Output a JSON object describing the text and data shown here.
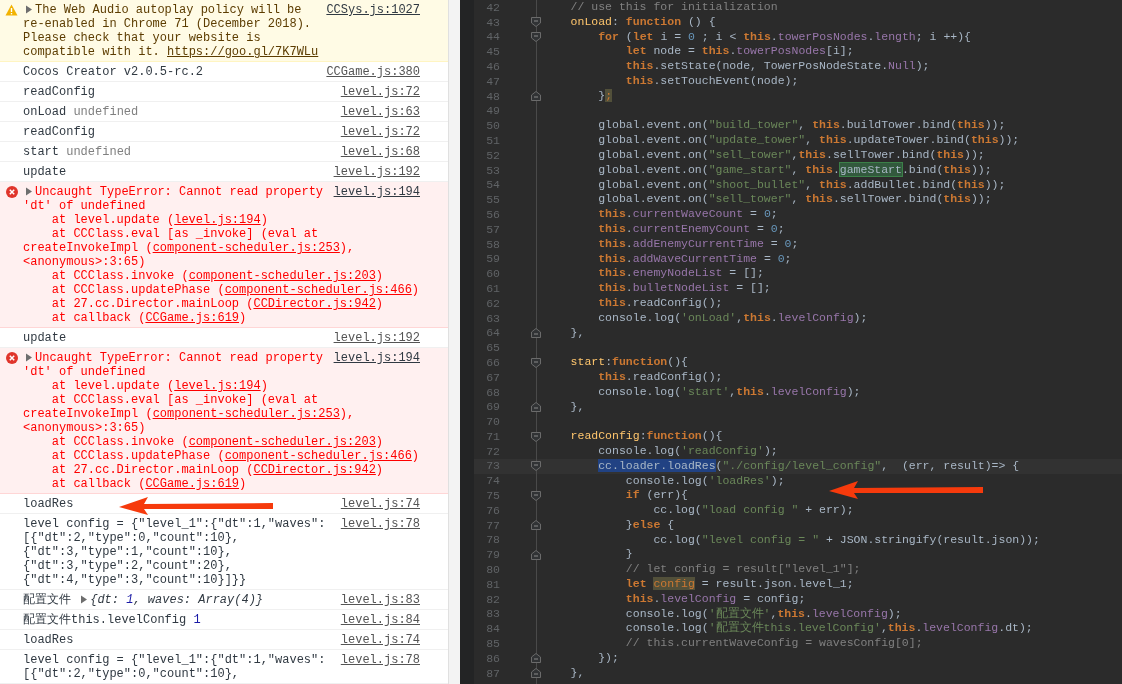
{
  "console": {
    "entries": [
      {
        "kind": "warning",
        "parts": [
          {
            "kind": "expander"
          },
          {
            "text": "The Web Audio autoplay policy will be re-enabled in Chrome 71 (December 2018). Please check that your website is compatible with it. ",
            "kind": "plain"
          },
          {
            "text": "https://goo.gl/7K7WLu",
            "kind": "link"
          }
        ],
        "source": "CCSys.js:1027"
      },
      {
        "kind": "log",
        "parts": [
          {
            "text": "Cocos Creator v2.0.5-rc.2",
            "kind": "plain"
          }
        ],
        "source": "CCGame.js:380"
      },
      {
        "kind": "log",
        "parts": [
          {
            "text": "readConfig",
            "kind": "plain"
          }
        ],
        "source": "level.js:72"
      },
      {
        "kind": "log",
        "parts": [
          {
            "text": "onLoad ",
            "kind": "plain"
          },
          {
            "text": "undefined",
            "kind": "dim"
          }
        ],
        "source": "level.js:63"
      },
      {
        "kind": "log",
        "parts": [
          {
            "text": "readConfig",
            "kind": "plain"
          }
        ],
        "source": "level.js:72"
      },
      {
        "kind": "log",
        "parts": [
          {
            "text": "start ",
            "kind": "plain"
          },
          {
            "text": "undefined",
            "kind": "dim"
          }
        ],
        "source": "level.js:68"
      },
      {
        "kind": "log",
        "parts": [
          {
            "text": "update",
            "kind": "plain"
          }
        ],
        "source": "level.js:192"
      },
      {
        "kind": "error",
        "parts": [
          {
            "kind": "expander"
          },
          {
            "text": "Uncaught TypeError: Cannot read property 'dt' of undefined",
            "kind": "plain"
          }
        ],
        "source": "level.js:194",
        "stack": [
          {
            "prefix": "at level.update (",
            "link": "level.js:194",
            "suffix": ")"
          },
          {
            "prefix": "at CCClass.eval [as _invoke] (eval at createInvokeImpl (",
            "link": "component-scheduler.js:253",
            "suffix": "), <anonymous>:3:65)"
          },
          {
            "prefix": "at CCClass.invoke (",
            "link": "component-scheduler.js:203",
            "suffix": ")"
          },
          {
            "prefix": "at CCClass.updatePhase (",
            "link": "component-scheduler.js:466",
            "suffix": ")"
          },
          {
            "prefix": "at 27.cc.Director.mainLoop (",
            "link": "CCDirector.js:942",
            "suffix": ")"
          },
          {
            "prefix": "at callback (",
            "link": "CCGame.js:619",
            "suffix": ")"
          }
        ]
      },
      {
        "kind": "log",
        "parts": [
          {
            "text": "update",
            "kind": "plain"
          }
        ],
        "source": "level.js:192"
      },
      {
        "kind": "error",
        "parts": [
          {
            "kind": "expander"
          },
          {
            "text": "Uncaught TypeError: Cannot read property 'dt' of undefined",
            "kind": "plain"
          }
        ],
        "source": "level.js:194",
        "stack": [
          {
            "prefix": "at level.update (",
            "link": "level.js:194",
            "suffix": ")"
          },
          {
            "prefix": "at CCClass.eval [as _invoke] (eval at createInvokeImpl (",
            "link": "component-scheduler.js:253",
            "suffix": "), <anonymous>:3:65)"
          },
          {
            "prefix": "at CCClass.invoke (",
            "link": "component-scheduler.js:203",
            "suffix": ")"
          },
          {
            "prefix": "at CCClass.updatePhase (",
            "link": "component-scheduler.js:466",
            "suffix": ")"
          },
          {
            "prefix": "at 27.cc.Director.mainLoop (",
            "link": "CCDirector.js:942",
            "suffix": ")"
          },
          {
            "prefix": "at callback (",
            "link": "CCGame.js:619",
            "suffix": ")"
          }
        ]
      },
      {
        "kind": "log",
        "parts": [
          {
            "text": "loadRes",
            "kind": "plain"
          }
        ],
        "source": "level.js:74"
      },
      {
        "kind": "log",
        "parts": [
          {
            "text": "level config = {\"level_1\":{\"dt\":1,\"waves\":[{\"dt\":2,\"type\":0,\"count\":10},{\"dt\":3,\"type\":1,\"count\":10},{\"dt\":3,\"type\":2,\"count\":20},{\"dt\":4,\"type\":3,\"count\":10}]}}",
            "kind": "plain"
          }
        ],
        "source": "level.js:78"
      },
      {
        "kind": "log",
        "parts": [
          {
            "text": "配置文件 ",
            "kind": "plain"
          },
          {
            "kind": "expander"
          },
          {
            "text": "{dt: ",
            "kind": "object"
          },
          {
            "text": "1",
            "kind": "object-number"
          },
          {
            "text": ", waves: Array(4)}",
            "kind": "object"
          }
        ],
        "source": "level.js:83"
      },
      {
        "kind": "log",
        "parts": [
          {
            "text": "配置文件this.levelConfig ",
            "kind": "plain"
          },
          {
            "text": "1",
            "kind": "number"
          }
        ],
        "source": "level.js:84"
      },
      {
        "kind": "log",
        "parts": [
          {
            "text": "loadRes",
            "kind": "plain"
          }
        ],
        "source": "level.js:74"
      },
      {
        "kind": "log",
        "parts": [
          {
            "text": "level config = {\"level_1\":{\"dt\":1,\"waves\":[{\"dt\":2,\"type\":0,\"count\":10},",
            "kind": "plain"
          }
        ],
        "source": "level.js:78"
      }
    ]
  },
  "editor": {
    "lines": [
      {
        "number": "42",
        "tokens": [
          {
            "text": "    // use this for initialization",
            "kind": "comment"
          }
        ]
      },
      {
        "number": "43",
        "fold_start": true,
        "tokens": [
          {
            "text": "    onLoad",
            "kind": "function"
          },
          {
            "text": ": ",
            "kind": "plain"
          },
          {
            "text": "function",
            "kind": "keyword"
          },
          {
            "text": " () {",
            "kind": "plain"
          }
        ]
      },
      {
        "number": "44",
        "fold_start": true,
        "tokens": [
          {
            "text": "        for",
            "kind": "keyword"
          },
          {
            "text": " (",
            "kind": "plain"
          },
          {
            "text": "let",
            "kind": "keyword"
          },
          {
            "text": " i = ",
            "kind": "plain"
          },
          {
            "text": "0",
            "kind": "number"
          },
          {
            "text": " ; i < ",
            "kind": "plain"
          },
          {
            "text": "this",
            "kind": "keyword"
          },
          {
            "text": ".",
            "kind": "plain"
          },
          {
            "text": "towerPosNodes",
            "kind": "property"
          },
          {
            "text": ".",
            "kind": "plain"
          },
          {
            "text": "length",
            "kind": "property"
          },
          {
            "text": "; i ++){",
            "kind": "plain"
          }
        ]
      },
      {
        "number": "45",
        "tokens": [
          {
            "text": "            let",
            "kind": "keyword"
          },
          {
            "text": " node = ",
            "kind": "plain"
          },
          {
            "text": "this",
            "kind": "keyword"
          },
          {
            "text": ".",
            "kind": "plain"
          },
          {
            "text": "towerPosNodes",
            "kind": "property"
          },
          {
            "text": "[i];",
            "kind": "plain"
          }
        ]
      },
      {
        "number": "46",
        "tokens": [
          {
            "text": "            this",
            "kind": "keyword"
          },
          {
            "text": ".setState(node, TowerPosNodeState.",
            "kind": "plain"
          },
          {
            "text": "Null",
            "kind": "property"
          },
          {
            "text": ");",
            "kind": "plain"
          }
        ]
      },
      {
        "number": "47",
        "tokens": [
          {
            "text": "            this",
            "kind": "keyword"
          },
          {
            "text": ".setTouchEvent(node);",
            "kind": "plain"
          }
        ]
      },
      {
        "number": "48",
        "fold_end": true,
        "tokens": [
          {
            "text": "        }",
            "kind": "plain"
          },
          {
            "text": ";",
            "kind": "reference"
          }
        ]
      },
      {
        "number": "49"
      },
      {
        "number": "50",
        "tokens": [
          {
            "text": "        global.event.on(",
            "kind": "plain"
          },
          {
            "text": "\"build_tower\"",
            "kind": "string"
          },
          {
            "text": ", ",
            "kind": "plain"
          },
          {
            "text": "this",
            "kind": "keyword"
          },
          {
            "text": ".buildTower.bind(",
            "kind": "plain"
          },
          {
            "text": "this",
            "kind": "keyword"
          },
          {
            "text": "));",
            "kind": "plain"
          }
        ]
      },
      {
        "number": "51",
        "tokens": [
          {
            "text": "        global.event.on(",
            "kind": "plain"
          },
          {
            "text": "\"update_tower\"",
            "kind": "string"
          },
          {
            "text": ", ",
            "kind": "plain"
          },
          {
            "text": "this",
            "kind": "keyword"
          },
          {
            "text": ".updateTower.bind(",
            "kind": "plain"
          },
          {
            "text": "this",
            "kind": "keyword"
          },
          {
            "text": "));",
            "kind": "plain"
          }
        ]
      },
      {
        "number": "52",
        "tokens": [
          {
            "text": "        global.event.on(",
            "kind": "plain"
          },
          {
            "text": "\"sell_tower\"",
            "kind": "string"
          },
          {
            "text": ",",
            "kind": "plain"
          },
          {
            "text": "this",
            "kind": "keyword"
          },
          {
            "text": ".sellTower.bind(",
            "kind": "plain"
          },
          {
            "text": "this",
            "kind": "keyword"
          },
          {
            "text": "));",
            "kind": "plain"
          }
        ]
      },
      {
        "number": "53",
        "tokens": [
          {
            "text": "        global.event.on(",
            "kind": "plain"
          },
          {
            "text": "\"game_start\"",
            "kind": "string"
          },
          {
            "text": ", ",
            "kind": "plain"
          },
          {
            "text": "this",
            "kind": "keyword"
          },
          {
            "text": ".",
            "kind": "plain"
          },
          {
            "text": "gameStart",
            "kind": "match"
          },
          {
            "text": ".bind(",
            "kind": "plain"
          },
          {
            "text": "this",
            "kind": "keyword"
          },
          {
            "text": "));",
            "kind": "plain"
          }
        ]
      },
      {
        "number": "54",
        "tokens": [
          {
            "text": "        global.event.on(",
            "kind": "plain"
          },
          {
            "text": "\"shoot_bullet\"",
            "kind": "string"
          },
          {
            "text": ", ",
            "kind": "plain"
          },
          {
            "text": "this",
            "kind": "keyword"
          },
          {
            "text": ".addBullet.bind(",
            "kind": "plain"
          },
          {
            "text": "this",
            "kind": "keyword"
          },
          {
            "text": "));",
            "kind": "plain"
          }
        ]
      },
      {
        "number": "55",
        "tokens": [
          {
            "text": "        global.event.on(",
            "kind": "plain"
          },
          {
            "text": "\"sell_tower\"",
            "kind": "string"
          },
          {
            "text": ", ",
            "kind": "plain"
          },
          {
            "text": "this",
            "kind": "keyword"
          },
          {
            "text": ".sellTower.bind(",
            "kind": "plain"
          },
          {
            "text": "this",
            "kind": "keyword"
          },
          {
            "text": "));",
            "kind": "plain"
          }
        ]
      },
      {
        "number": "56",
        "tokens": [
          {
            "text": "        this",
            "kind": "keyword"
          },
          {
            "text": ".",
            "kind": "plain"
          },
          {
            "text": "currentWaveCount",
            "kind": "property"
          },
          {
            "text": " = ",
            "kind": "plain"
          },
          {
            "text": "0",
            "kind": "number"
          },
          {
            "text": ";",
            "kind": "plain"
          }
        ]
      },
      {
        "number": "57",
        "tokens": [
          {
            "text": "        this",
            "kind": "keyword"
          },
          {
            "text": ".",
            "kind": "plain"
          },
          {
            "text": "currentEnemyCount",
            "kind": "property"
          },
          {
            "text": " = ",
            "kind": "plain"
          },
          {
            "text": "0",
            "kind": "number"
          },
          {
            "text": ";",
            "kind": "plain"
          }
        ]
      },
      {
        "number": "58",
        "tokens": [
          {
            "text": "        this",
            "kind": "keyword"
          },
          {
            "text": ".",
            "kind": "plain"
          },
          {
            "text": "addEnemyCurrentTime",
            "kind": "property"
          },
          {
            "text": " = ",
            "kind": "plain"
          },
          {
            "text": "0",
            "kind": "number"
          },
          {
            "text": ";",
            "kind": "plain"
          }
        ]
      },
      {
        "number": "59",
        "tokens": [
          {
            "text": "        this",
            "kind": "keyword"
          },
          {
            "text": ".",
            "kind": "plain"
          },
          {
            "text": "addWaveCurrentTime",
            "kind": "property"
          },
          {
            "text": " = ",
            "kind": "plain"
          },
          {
            "text": "0",
            "kind": "number"
          },
          {
            "text": ";",
            "kind": "plain"
          }
        ]
      },
      {
        "number": "60",
        "tokens": [
          {
            "text": "        this",
            "kind": "keyword"
          },
          {
            "text": ".",
            "kind": "plain"
          },
          {
            "text": "enemyNodeList",
            "kind": "property"
          },
          {
            "text": " = [];",
            "kind": "plain"
          }
        ]
      },
      {
        "number": "61",
        "tokens": [
          {
            "text": "        this",
            "kind": "keyword"
          },
          {
            "text": ".",
            "kind": "plain"
          },
          {
            "text": "bulletNodeList",
            "kind": "property"
          },
          {
            "text": " = [];",
            "kind": "plain"
          }
        ]
      },
      {
        "number": "62",
        "tokens": [
          {
            "text": "        this",
            "kind": "keyword"
          },
          {
            "text": ".readConfig();",
            "kind": "plain"
          }
        ]
      },
      {
        "number": "63",
        "tokens": [
          {
            "text": "        console.log(",
            "kind": "plain"
          },
          {
            "text": "'onLoad'",
            "kind": "string"
          },
          {
            "text": ",",
            "kind": "plain"
          },
          {
            "text": "this",
            "kind": "keyword"
          },
          {
            "text": ".",
            "kind": "plain"
          },
          {
            "text": "levelConfig",
            "kind": "property"
          },
          {
            "text": ");",
            "kind": "plain"
          }
        ]
      },
      {
        "number": "64",
        "fold_end": true,
        "tokens": [
          {
            "text": "    },",
            "kind": "plain"
          }
        ]
      },
      {
        "number": "65"
      },
      {
        "number": "66",
        "fold_start": true,
        "tokens": [
          {
            "text": "    start",
            "kind": "function"
          },
          {
            "text": ":",
            "kind": "plain"
          },
          {
            "text": "function",
            "kind": "keyword"
          },
          {
            "text": "(){",
            "kind": "plain"
          }
        ]
      },
      {
        "number": "67",
        "tokens": [
          {
            "text": "        this",
            "kind": "keyword"
          },
          {
            "text": ".readConfig();",
            "kind": "plain"
          }
        ]
      },
      {
        "number": "68",
        "tokens": [
          {
            "text": "        console.log(",
            "kind": "plain"
          },
          {
            "text": "'start'",
            "kind": "string"
          },
          {
            "text": ",",
            "kind": "plain"
          },
          {
            "text": "this",
            "kind": "keyword"
          },
          {
            "text": ".",
            "kind": "plain"
          },
          {
            "text": "levelConfig",
            "kind": "property"
          },
          {
            "text": ");",
            "kind": "plain"
          }
        ]
      },
      {
        "number": "69",
        "fold_end": true,
        "tokens": [
          {
            "text": "    },",
            "kind": "plain"
          }
        ]
      },
      {
        "number": "70"
      },
      {
        "number": "71",
        "fold_start": true,
        "tokens": [
          {
            "text": "    readConfig",
            "kind": "function"
          },
          {
            "text": ":",
            "kind": "plain"
          },
          {
            "text": "function",
            "kind": "keyword"
          },
          {
            "text": "(){",
            "kind": "plain"
          }
        ]
      },
      {
        "number": "72",
        "tokens": [
          {
            "text": "        console.log(",
            "kind": "plain"
          },
          {
            "text": "'readConfig'",
            "kind": "string"
          },
          {
            "text": ");",
            "kind": "plain"
          }
        ]
      },
      {
        "number": "73",
        "fold_start": true,
        "current": true,
        "tokens": [
          {
            "text": "        cc.loader.loadRes",
            "kind": "selection"
          },
          {
            "text": "(",
            "kind": "plain"
          },
          {
            "text": "\"./config/level_config\"",
            "kind": "string"
          },
          {
            "text": ",  (err, result)=> {",
            "kind": "plain"
          }
        ]
      },
      {
        "number": "74",
        "tokens": [
          {
            "text": "            console.log(",
            "kind": "plain"
          },
          {
            "text": "'loadRes'",
            "kind": "string"
          },
          {
            "text": ");",
            "kind": "plain"
          }
        ]
      },
      {
        "number": "75",
        "fold_start": true,
        "tokens": [
          {
            "text": "            if",
            "kind": "keyword"
          },
          {
            "text": " (err){",
            "kind": "plain"
          }
        ]
      },
      {
        "number": "76",
        "tokens": [
          {
            "text": "                cc.log(",
            "kind": "plain"
          },
          {
            "text": "\"load config \"",
            "kind": "string"
          },
          {
            "text": " + err);",
            "kind": "plain"
          }
        ]
      },
      {
        "number": "77",
        "fold_end": true,
        "tokens": [
          {
            "text": "            }",
            "kind": "plain"
          },
          {
            "text": "else",
            "kind": "keyword"
          },
          {
            "text": " {",
            "kind": "plain"
          }
        ]
      },
      {
        "number": "78",
        "tokens": [
          {
            "text": "                cc.log(",
            "kind": "plain"
          },
          {
            "text": "\"level config = \"",
            "kind": "string"
          },
          {
            "text": " + JSON.stringify(result.json));",
            "kind": "plain"
          }
        ]
      },
      {
        "number": "79",
        "fold_end": true,
        "tokens": [
          {
            "text": "            }",
            "kind": "plain"
          }
        ]
      },
      {
        "number": "80",
        "tokens": [
          {
            "text": "            // let config = result[\"level_1\"];",
            "kind": "comment"
          }
        ]
      },
      {
        "number": "81",
        "tokens": [
          {
            "text": "            let",
            "kind": "keyword"
          },
          {
            "text": " config",
            "kind": "reference"
          },
          {
            "text": " = result.json.level_1;",
            "kind": "plain"
          }
        ]
      },
      {
        "number": "82",
        "tokens": [
          {
            "text": "            this",
            "kind": "keyword"
          },
          {
            "text": ".",
            "kind": "plain"
          },
          {
            "text": "levelConfig",
            "kind": "property"
          },
          {
            "text": " = config;",
            "kind": "plain"
          }
        ]
      },
      {
        "number": "83",
        "tokens": [
          {
            "text": "            console.log(",
            "kind": "plain"
          },
          {
            "text": "'配置文件'",
            "kind": "string"
          },
          {
            "text": ",",
            "kind": "plain"
          },
          {
            "text": "this",
            "kind": "keyword"
          },
          {
            "text": ".",
            "kind": "plain"
          },
          {
            "text": "levelConfig",
            "kind": "property"
          },
          {
            "text": ");",
            "kind": "plain"
          }
        ]
      },
      {
        "number": "84",
        "tokens": [
          {
            "text": "            console.log(",
            "kind": "plain"
          },
          {
            "text": "'配置文件this.levelConfig'",
            "kind": "string"
          },
          {
            "text": ",",
            "kind": "plain"
          },
          {
            "text": "this",
            "kind": "keyword"
          },
          {
            "text": ".",
            "kind": "plain"
          },
          {
            "text": "levelConfig",
            "kind": "property"
          },
          {
            "text": ".dt);",
            "kind": "plain"
          }
        ]
      },
      {
        "number": "85",
        "tokens": [
          {
            "text": "            // this.currentWaveConfig = wavesConfig[0];",
            "kind": "comment"
          }
        ]
      },
      {
        "number": "86",
        "fold_end": true,
        "tokens": [
          {
            "text": "        });",
            "kind": "plain"
          }
        ]
      },
      {
        "number": "87",
        "fold_end": true,
        "tokens": [
          {
            "text": "    },",
            "kind": "plain"
          }
        ]
      }
    ]
  }
}
